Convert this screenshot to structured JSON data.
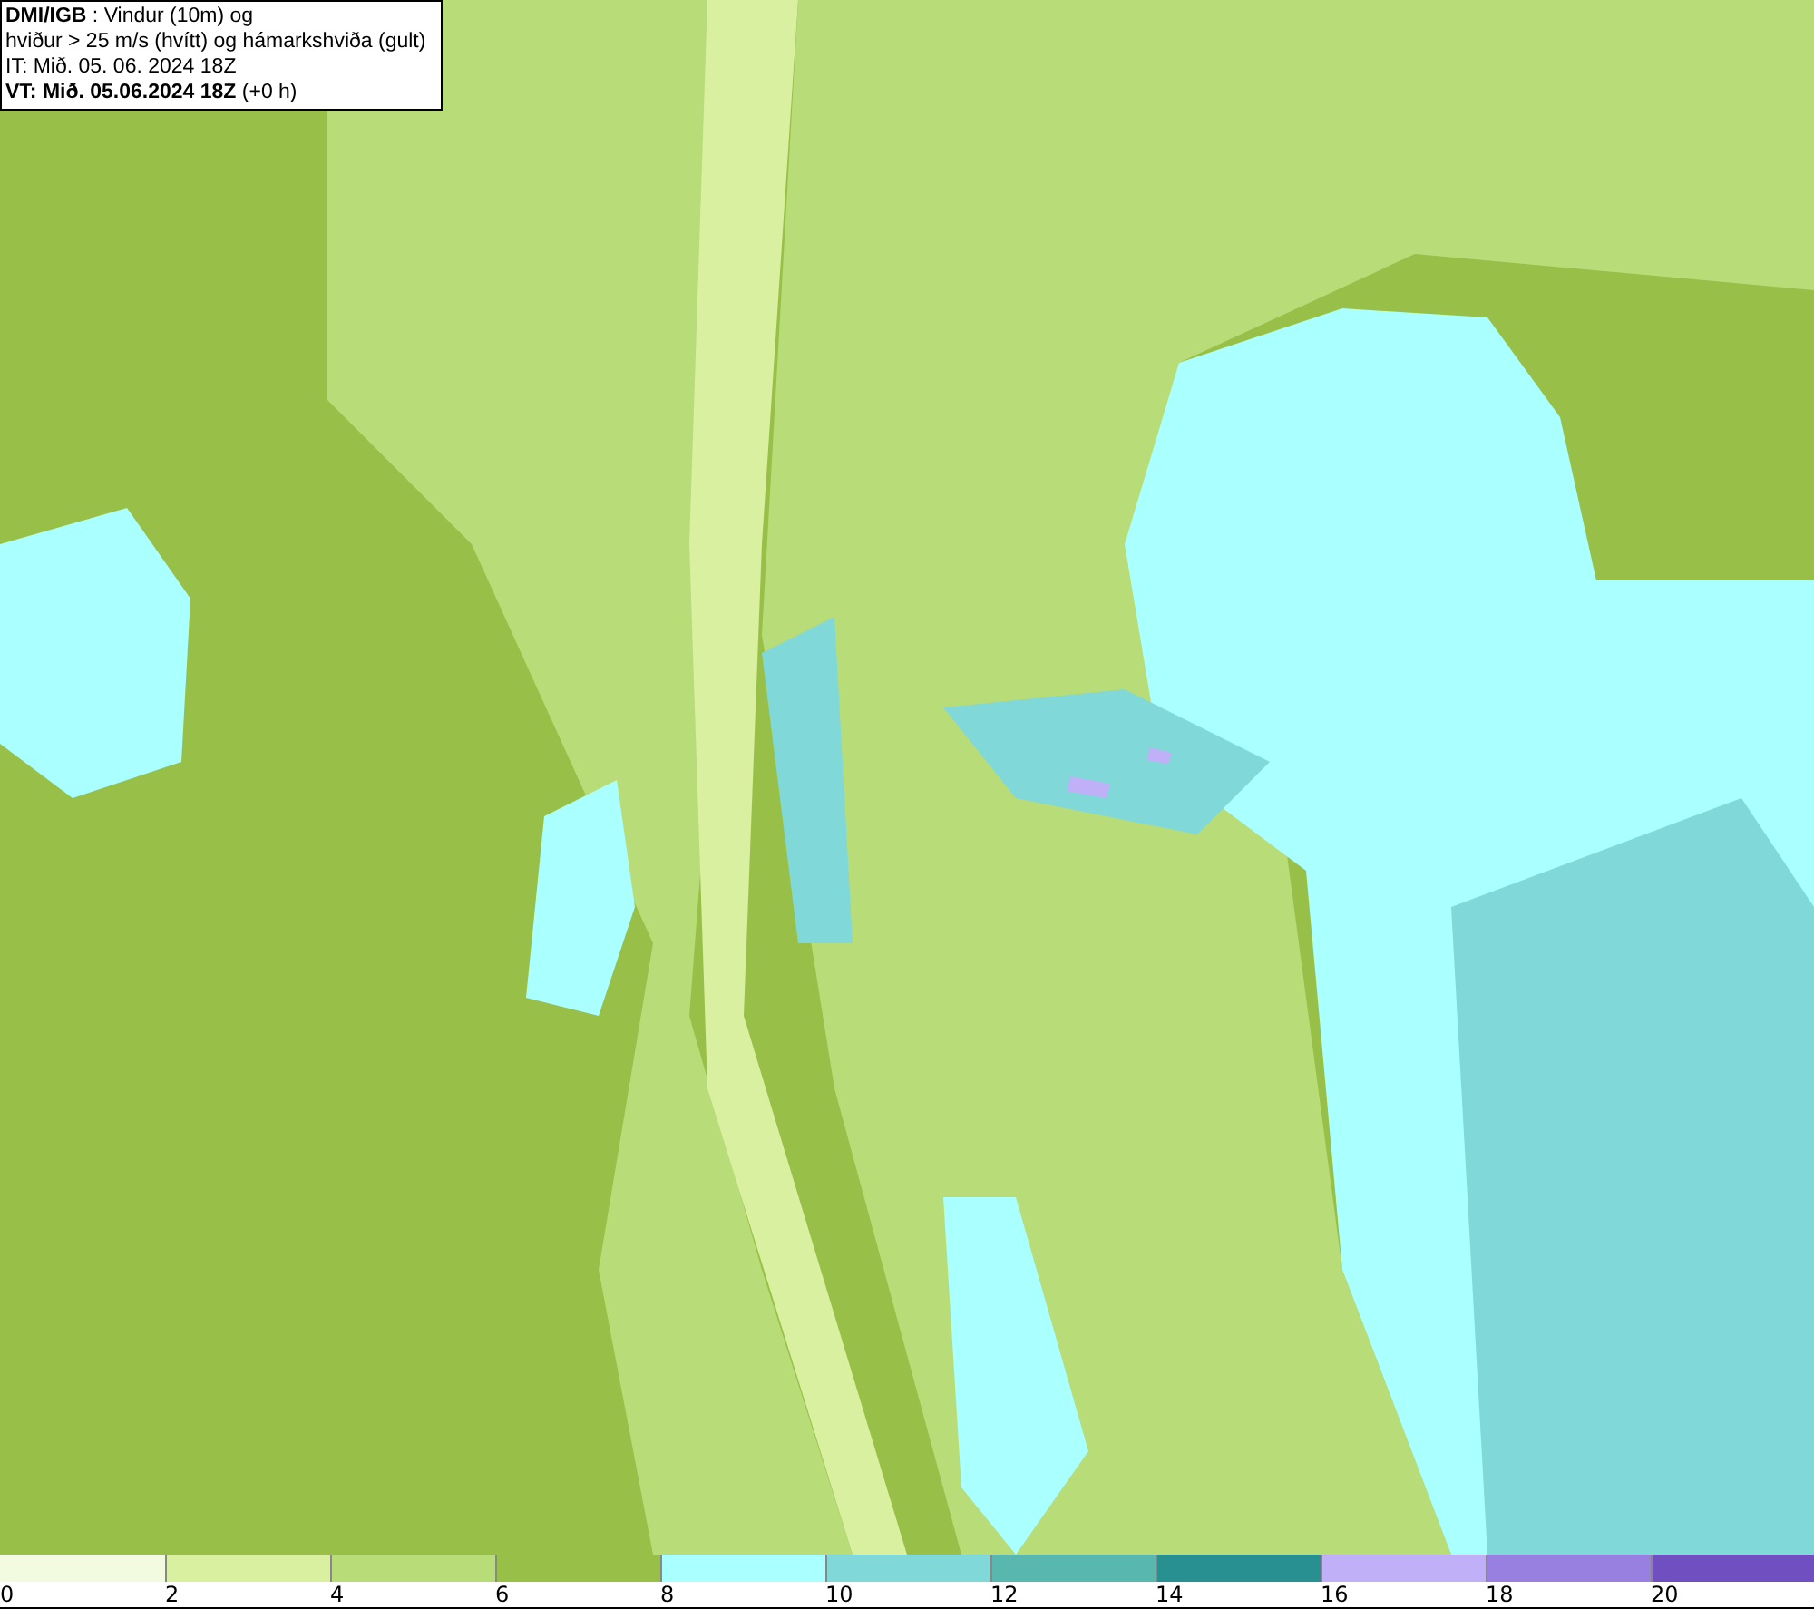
{
  "header": {
    "lines": [
      "**DMI/IGB** : Vindur (10m) og",
      "hviður > 25 m/s (hvítt) og hámarkshviða (gult)",
      "IT: Mið. 05. 06. 2024 18Z",
      "**VT: Mið. 05.06.2024 18Z** (+0 h)"
    ]
  },
  "legend": [
    {
      "label": "0",
      "color": "#f2fadf"
    },
    {
      "label": "2",
      "color": "#d8f0a0"
    },
    {
      "label": "4",
      "color": "#b8dc78"
    },
    {
      "label": "6",
      "color": "#98c048"
    },
    {
      "label": "8",
      "color": "#aaffff"
    },
    {
      "label": "10",
      "color": "#80d8d8"
    },
    {
      "label": "12",
      "color": "#58b8b0"
    },
    {
      "label": "14",
      "color": "#289090"
    },
    {
      "label": "16",
      "color": "#c0b0f8"
    },
    {
      "label": "18",
      "color": "#9880e0"
    },
    {
      "label": "20",
      "color": "#7050c0"
    }
  ]
}
